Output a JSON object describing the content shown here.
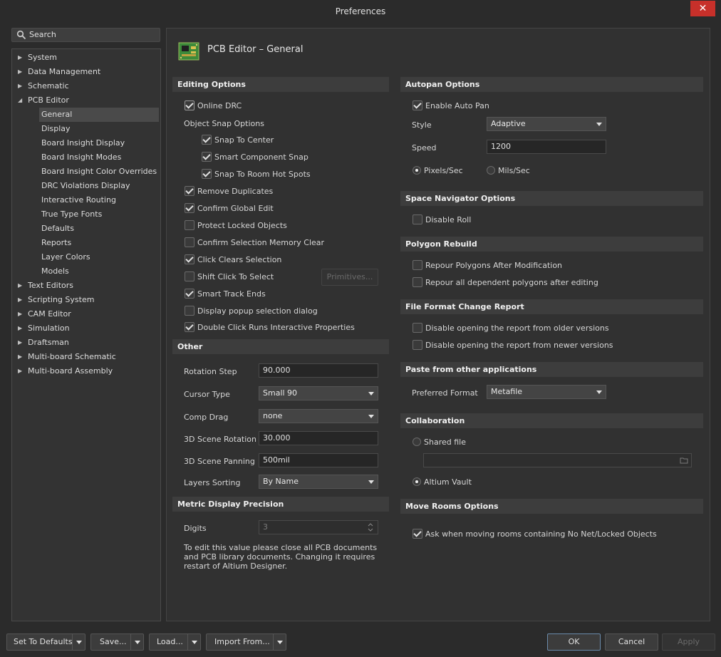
{
  "window": {
    "title": "Preferences",
    "close_glyph": "✕"
  },
  "search": {
    "placeholder": "Search"
  },
  "tree": [
    {
      "label": "System",
      "expanded": false
    },
    {
      "label": "Data Management",
      "expanded": false
    },
    {
      "label": "Schematic",
      "expanded": false
    },
    {
      "label": "PCB Editor",
      "expanded": true
    },
    {
      "label": "General",
      "child": true,
      "selected": true
    },
    {
      "label": "Display",
      "child": true
    },
    {
      "label": "Board Insight Display",
      "child": true
    },
    {
      "label": "Board Insight Modes",
      "child": true
    },
    {
      "label": "Board Insight Color Overrides",
      "child": true
    },
    {
      "label": "DRC Violations Display",
      "child": true
    },
    {
      "label": "Interactive Routing",
      "child": true
    },
    {
      "label": "True Type Fonts",
      "child": true
    },
    {
      "label": "Defaults",
      "child": true
    },
    {
      "label": "Reports",
      "child": true
    },
    {
      "label": "Layer Colors",
      "child": true
    },
    {
      "label": "Models",
      "child": true
    },
    {
      "label": "Text Editors",
      "expanded": false
    },
    {
      "label": "Scripting System",
      "expanded": false
    },
    {
      "label": "CAM Editor",
      "expanded": false
    },
    {
      "label": "Simulation",
      "expanded": false
    },
    {
      "label": "Draftsman",
      "expanded": false
    },
    {
      "label": "Multi-board Schematic",
      "expanded": false
    },
    {
      "label": "Multi-board Assembly",
      "expanded": false
    }
  ],
  "page": {
    "title": "PCB Editor – General"
  },
  "editing": {
    "header": "Editing Options",
    "online_drc": "Online DRC",
    "object_snap": "Object Snap Options",
    "snap_center": "Snap To Center",
    "smart_component": "Smart Component Snap",
    "snap_room": "Snap To Room Hot Spots",
    "remove_dup": "Remove Duplicates",
    "confirm_global": "Confirm Global Edit",
    "protect_locked": "Protect Locked Objects",
    "confirm_sel_mem": "Confirm Selection Memory Clear",
    "click_clears": "Click Clears Selection",
    "shift_click": "Shift Click To Select",
    "primitives": "Primitives...",
    "smart_track": "Smart Track Ends",
    "display_popup": "Display popup selection dialog",
    "double_click": "Double Click Runs Interactive Properties"
  },
  "other": {
    "header": "Other",
    "rotation_step_label": "Rotation Step",
    "rotation_step_value": "90.000",
    "cursor_type_label": "Cursor Type",
    "cursor_type_value": "Small 90",
    "comp_drag_label": "Comp Drag",
    "comp_drag_value": "none",
    "scene_rotation_label": "3D Scene Rotation",
    "scene_rotation_value": "30.000",
    "scene_panning_label": "3D Scene Panning",
    "scene_panning_value": "500mil",
    "layers_sorting_label": "Layers Sorting",
    "layers_sorting_value": "By Name"
  },
  "metric": {
    "header": "Metric Display Precision",
    "digits_label": "Digits",
    "digits_value": "3",
    "note": "To edit this value please close all PCB documents and PCB library documents. Changing it requires restart of Altium Designer."
  },
  "autopan": {
    "header": "Autopan Options",
    "enable": "Enable Auto Pan",
    "style_label": "Style",
    "style_value": "Adaptive",
    "speed_label": "Speed",
    "speed_value": "1200",
    "pixels": "Pixels/Sec",
    "mils": "Mils/Sec"
  },
  "space_nav": {
    "header": "Space Navigator Options",
    "disable_roll": "Disable Roll"
  },
  "polygon": {
    "header": "Polygon Rebuild",
    "repour_after": "Repour Polygons After Modification",
    "repour_all": "Repour all dependent polygons after editing"
  },
  "file_format": {
    "header": "File Format Change Report",
    "older": "Disable opening the report from older versions",
    "newer": "Disable opening the report from newer versions"
  },
  "paste": {
    "header": "Paste from other applications",
    "preferred_label": "Preferred Format",
    "preferred_value": "Metafile"
  },
  "collab": {
    "header": "Collaboration",
    "shared_file": "Shared file",
    "shared_path": "",
    "vault": "Altium Vault"
  },
  "move_rooms": {
    "header": "Move Rooms Options",
    "ask": "Ask when moving rooms containing No Net/Locked Objects"
  },
  "footer": {
    "defaults": "Set To Defaults",
    "save": "Save...",
    "load": "Load...",
    "import": "Import From...",
    "ok": "OK",
    "cancel": "Cancel",
    "apply": "Apply"
  }
}
